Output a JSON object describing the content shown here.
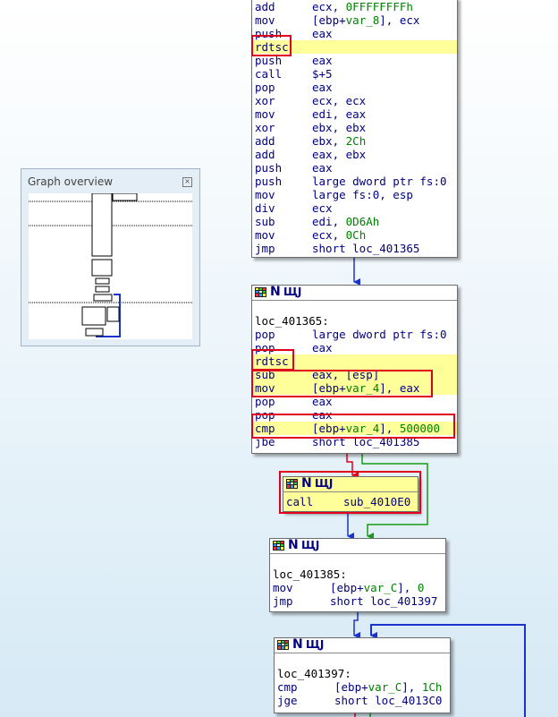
{
  "overview": {
    "title": "Graph overview",
    "close_icon": "close-icon"
  },
  "block1": {
    "lines": [
      {
        "mn": "add",
        "op": "ecx, ",
        "num": "0FFFFFFFFh"
      },
      {
        "mn": "mov",
        "op": "[ebp+",
        "var": "var_8",
        "op2": "], ecx"
      },
      {
        "mn": "push",
        "op": "eax"
      },
      {
        "mn": "rdtsc",
        "op": ""
      },
      {
        "mn": "push",
        "op": "eax"
      },
      {
        "mn": "call",
        "op": "$+5"
      },
      {
        "mn": "pop",
        "op": "eax"
      },
      {
        "mn": "xor",
        "op": "ecx, ecx"
      },
      {
        "mn": "mov",
        "op": "edi, eax"
      },
      {
        "mn": "xor",
        "op": "ebx, ebx"
      },
      {
        "mn": "add",
        "op": "ebx, ",
        "num": "2Ch"
      },
      {
        "mn": "add",
        "op": "eax, ebx"
      },
      {
        "mn": "push",
        "op": "eax"
      },
      {
        "mn": "push",
        "op": "large dword ptr fs:0"
      },
      {
        "mn": "mov",
        "op": "large fs:0, esp"
      },
      {
        "mn": "div",
        "op": "ecx"
      },
      {
        "mn": "sub",
        "op": "edi, ",
        "num": "0D6Ah"
      },
      {
        "mn": "mov",
        "op": "ecx, ",
        "num": "0Ch"
      },
      {
        "mn": "jmp",
        "op": "short loc_401365"
      }
    ]
  },
  "block2": {
    "label": "loc_401365:",
    "lines": [
      {
        "mn": "pop",
        "op": "large dword ptr fs:0"
      },
      {
        "mn": "pop",
        "op": "eax"
      },
      {
        "mn": "rdtsc",
        "op": ""
      },
      {
        "mn": "sub",
        "op": "eax, [esp]"
      },
      {
        "mn": "mov",
        "op": "[ebp+",
        "var": "var_4",
        "op2": "], eax"
      },
      {
        "mn": "pop",
        "op": "eax"
      },
      {
        "mn": "pop",
        "op": "eax"
      },
      {
        "mn": "cmp",
        "op": "[ebp+",
        "var": "var_4",
        "op2": "], ",
        "num": "500000"
      },
      {
        "mn": "jbe",
        "op": "short loc_401385"
      }
    ]
  },
  "block3": {
    "lines": [
      {
        "mn": "call",
        "op": "sub_4010E0"
      }
    ]
  },
  "block4": {
    "label": "loc_401385:",
    "lines": [
      {
        "mn": "mov",
        "op": "[ebp+",
        "var": "var_C",
        "op2": "], ",
        "num": "0"
      },
      {
        "mn": "jmp",
        "op": "short loc_401397"
      }
    ]
  },
  "block5": {
    "label": "loc_401397:",
    "lines": [
      {
        "mn": "cmp",
        "op": "[ebp+",
        "var": "var_C",
        "op2": "], ",
        "num": "1Ch"
      },
      {
        "mn": "jge",
        "op": "short loc_4013C0"
      }
    ]
  },
  "colors": {
    "edge_blue": "#1a33cc",
    "edge_red": "#e0001b",
    "edge_green": "#169b16",
    "highlight": "#ffff99",
    "box_red": "#e0001b"
  },
  "icons": {
    "header": [
      "grid-icon",
      "n-icon",
      "flow-icon"
    ]
  }
}
